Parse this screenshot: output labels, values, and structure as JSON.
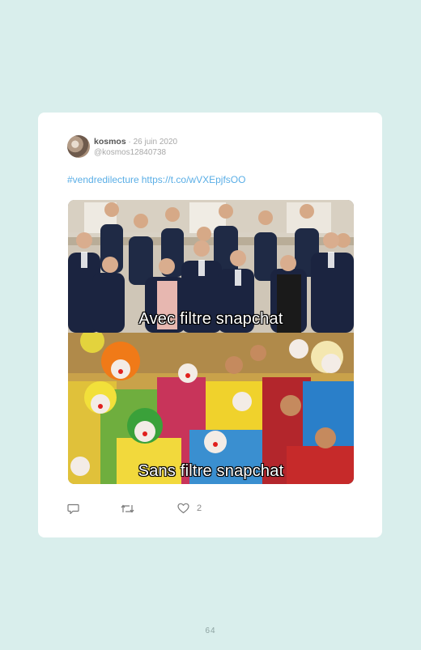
{
  "tweet": {
    "author_name": "kosmos",
    "separator": "·",
    "date": "26 juin 2020",
    "handle": "@kosmos12840738",
    "hashtag": "#vendredilecture",
    "link": "https://t.co/wVXEpjfsOO"
  },
  "media": {
    "top_caption": "Avec filtre snapchat",
    "bottom_caption": "Sans filtre snapchat"
  },
  "actions": {
    "reply_icon": "reply-icon",
    "retweet_icon": "retweet-icon",
    "like_icon": "heart-icon",
    "like_count": "2"
  },
  "page": {
    "number": "64"
  },
  "colors": {
    "background": "#d9eeec",
    "card": "#ffffff",
    "link": "#5aaee6"
  }
}
